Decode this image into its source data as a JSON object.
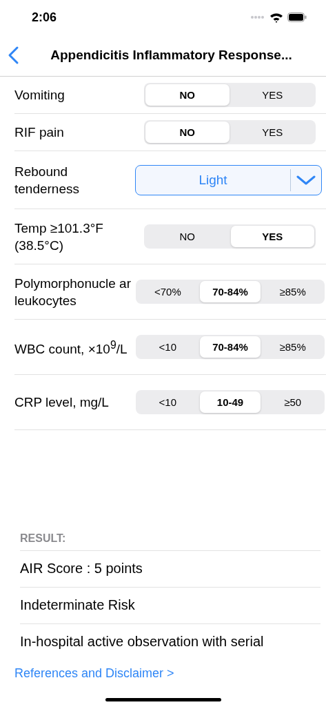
{
  "status_bar": {
    "time": "2:06"
  },
  "nav": {
    "title": "Appendicitis Inflammatory Response..."
  },
  "rows": [
    {
      "kind": "segmented",
      "label": "Vomiting",
      "options": [
        {
          "label": "NO",
          "selected": true
        },
        {
          "label": "YES",
          "selected": false
        }
      ]
    },
    {
      "kind": "segmented",
      "label": "RIF pain",
      "options": [
        {
          "label": "NO",
          "selected": true
        },
        {
          "label": "YES",
          "selected": false
        }
      ]
    },
    {
      "kind": "dropdown",
      "label": "Rebound tenderness",
      "value": "Light"
    },
    {
      "kind": "segmented",
      "label": "Temp ≥101.3°F (38.5°C)",
      "options": [
        {
          "label": "NO",
          "selected": false
        },
        {
          "label": "YES",
          "selected": true
        }
      ]
    },
    {
      "kind": "segmented",
      "label": "Polymorphonucle ar leukocytes",
      "options": [
        {
          "label": "<70%",
          "selected": false
        },
        {
          "label": "70-84%",
          "selected": true
        },
        {
          "label": "≥85%",
          "selected": false
        }
      ]
    },
    {
      "kind": "segmented",
      "label": "WBC count, ×10$^{9}$/L",
      "options": [
        {
          "label": "<10",
          "selected": false
        },
        {
          "label": "70-84%",
          "selected": true
        },
        {
          "label": "≥85%",
          "selected": false
        }
      ]
    },
    {
      "kind": "segmented",
      "label": "CRP level, mg/L",
      "options": [
        {
          "label": "<10",
          "selected": false
        },
        {
          "label": "10-49",
          "selected": true
        },
        {
          "label": "≥50",
          "selected": false
        }
      ]
    }
  ],
  "result": {
    "heading": "RESULT:",
    "items": [
      "AIR Score : 5 points",
      "Indeterminate Risk",
      "In-hospital active observation with serial"
    ]
  },
  "footer_link": "References and Disclaimer >"
}
